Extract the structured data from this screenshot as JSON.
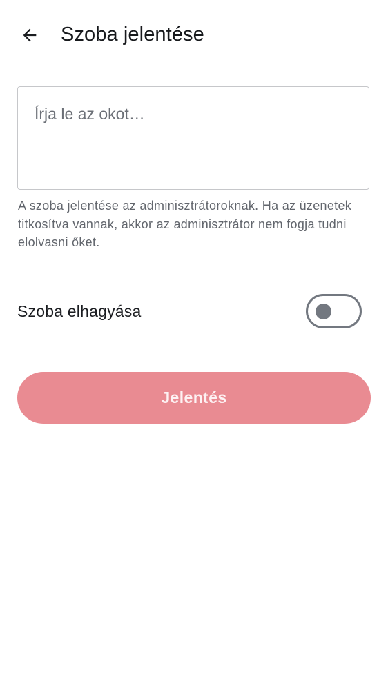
{
  "header": {
    "back_icon": "arrow-left-icon",
    "title": "Szoba jelentése"
  },
  "reason": {
    "placeholder": "Írja le az okot…",
    "value": ""
  },
  "helper_text": "A szoba jelentése az adminisztrátoroknak. Ha az üzenetek titkosítva vannak, akkor az adminisztrátor nem fogja tudni elolvasni őket.",
  "leave_room": {
    "label": "Szoba elhagyása",
    "enabled": false
  },
  "report_button": {
    "label": "Jelentés",
    "disabled": true
  },
  "colors": {
    "button_bg": "#e98b92",
    "switch_off": "#737880",
    "text_primary": "#1b1d21",
    "text_secondary": "#62666d"
  }
}
